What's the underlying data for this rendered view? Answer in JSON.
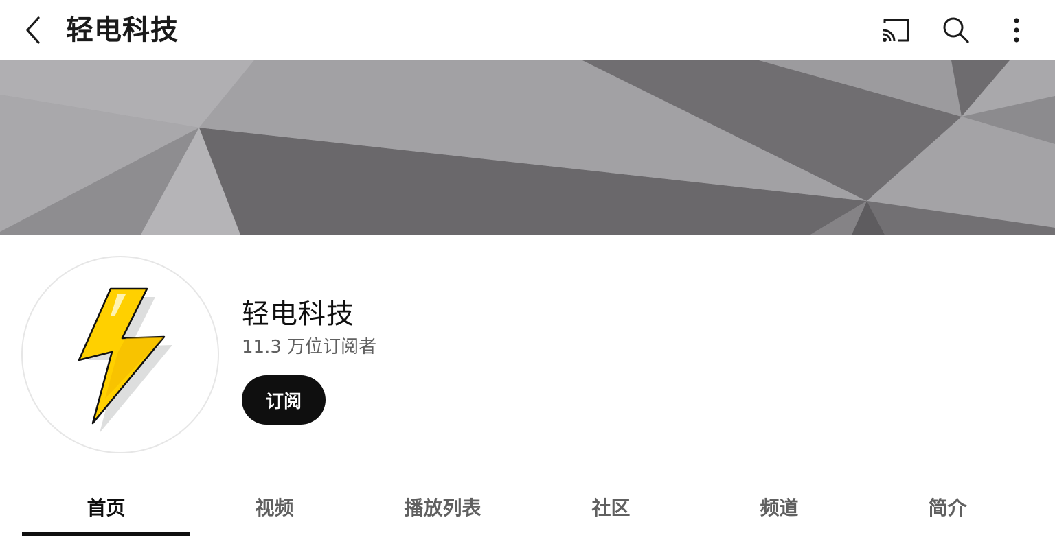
{
  "topbar": {
    "title": "轻电科技",
    "back_icon": "chevron-left-icon",
    "cast_icon": "cast-icon",
    "search_icon": "search-icon",
    "more_icon": "more-vert-icon"
  },
  "channel": {
    "name": "轻电科技",
    "subscribers": "11.3 万位订阅者",
    "avatar_icon": "lightning-bolt-icon",
    "subscribe_label": "订阅"
  },
  "tabs": [
    {
      "label": "首页",
      "active": true
    },
    {
      "label": "视频",
      "active": false
    },
    {
      "label": "播放列表",
      "active": false
    },
    {
      "label": "社区",
      "active": false
    },
    {
      "label": "频道",
      "active": false
    },
    {
      "label": "简介",
      "active": false
    }
  ],
  "colors": {
    "subscribe_bg": "#0f0f0f",
    "bolt_fill": "#ffd000",
    "text_primary": "#0f0f0f",
    "text_secondary": "#606060"
  }
}
